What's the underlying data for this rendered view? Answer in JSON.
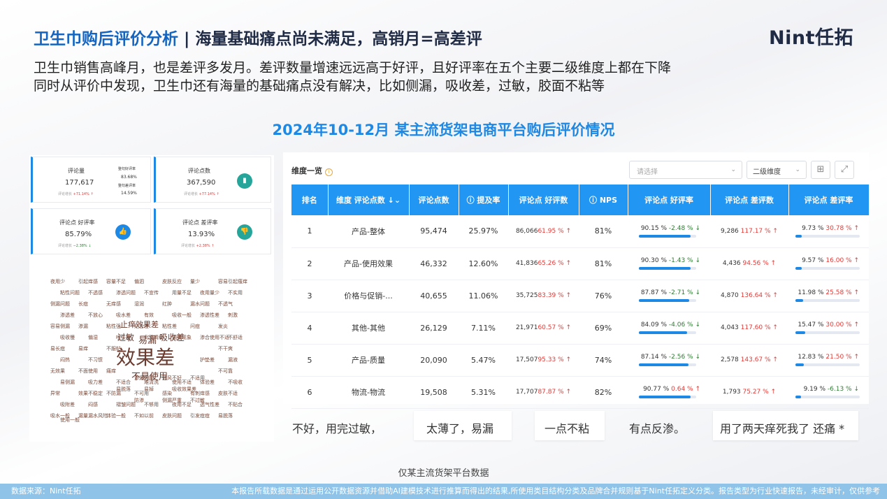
{
  "title": {
    "part1": "卫生巾购后评价分析",
    "sep": " | ",
    "part2": "海量基础痛点尚未满足，高销月=高差评"
  },
  "logo": "Nint任拓",
  "desc": [
    "卫生巾销售高峰月，也是差评多发月。差评数量增速远远高于好评，且好评率在五个主要二级维度上都在下降",
    "同时从评价中发现，卫生巾还有海量的基础痛点没有解决，比如侧漏，吸收差，过敏，胶面不粘等"
  ],
  "subtitle": "2024年10-12月 某主流货架电商平台购后评价情况",
  "stats": {
    "reviews": {
      "label": "评论量",
      "value": "177,617",
      "change_prefix": "评论增长",
      "change": "+71.14% ↑",
      "mini1_label": "整句好评率",
      "mini1": "83.68%",
      "mini2_label": "整句差评率",
      "mini2": "14.59%"
    },
    "points": {
      "label": "评论点数",
      "value": "367,590",
      "change_prefix": "评论增长",
      "change": "+77.14% ↑"
    },
    "good": {
      "label": "评论点 好评率",
      "value": "85.79%",
      "change_prefix": "评论增长",
      "change": "−2.38% ↓"
    },
    "bad": {
      "label": "评论点 差评率",
      "value": "13.93%",
      "change_prefix": "评论增长",
      "change": "+2.38% ↑"
    }
  },
  "cloud": {
    "big": "效果差",
    "mid": [
      "止痒效果差",
      "易漏",
      "吸收差",
      "过敏",
      "不易使用"
    ],
    "small": [
      "夜用少",
      "引起痒感",
      "容量不足",
      "偏泗",
      "皮肤反应",
      "量少",
      "容易引起瘙痒",
      "粘性问题",
      "不透感",
      "渗透问题",
      "不宣传",
      "用量不足",
      "夜用量少",
      "不实用",
      "侧漏问题",
      "长痘",
      "无痒感",
      "湿润",
      "红肿",
      "漏水问题",
      "不透气",
      "渗透差",
      "不放心",
      "吸水差",
      "有效",
      "吸收一般",
      "渗透性差",
      "刺激",
      "容易侧漏",
      "渗漏",
      "粘性强",
      "贴合差",
      "粘性差",
      "问痘",
      "发炎",
      "吸收慢",
      "偏湿",
      "喷头差",
      "负面情绪",
      "漏液现象",
      "渗合使用不适",
      "不舒适",
      "易长痘",
      "易痒",
      "不服帖",
      "渗漏问题",
      "通风不好",
      "不适用",
      "不干爽",
      "闷热",
      "不习惯",
      "易脱落",
      "易掉",
      "吸收效果差",
      "护垫差",
      "漏液",
      "无效果",
      "不面使用",
      "痛痒",
      "防渗",
      "侧漏严重",
      "不过敏",
      "不可靠",
      "易侧漏",
      "吸力差",
      "不适合",
      "难清洗",
      "使用不适",
      "体验差",
      "不吸收",
      "异常",
      "效果不稳定",
      "不防漏",
      "不可用",
      "感染",
      "有刺痒感",
      "皮肤不适",
      "吸附差",
      "闷感",
      "褶皱问题",
      "不够用",
      "夜用不足",
      "透气性差",
      "不贴合",
      "吸水一般",
      "漏量",
      "体验一般",
      "不如以前",
      "皮肤问题",
      "引发痘痘",
      "易脱落",
      "使用一般",
      "漏水风险"
    ]
  },
  "table": {
    "title": "维度一览",
    "select_placeholder": "请选择",
    "select2": "二级维度",
    "headers": [
      "排名",
      "维度 评论点数 ↓⌄",
      "评论点数",
      "ⓘ 提及率",
      "评论点 好评数",
      "ⓘ NPS",
      "评论点 好评率",
      "评论点 差评数",
      "评论点 差评率"
    ],
    "rows": [
      {
        "rank": "1",
        "dim": "产品-整体",
        "points": "95,474",
        "mention": "25.97%",
        "good_n": "86,066",
        "good_chg": "61.95 % ↑",
        "nps": "81%",
        "good_rate": "90.15 %",
        "good_rate_chg": "-2.48 % ↓",
        "good_fill": 0.9,
        "bad_n": "9,286",
        "bad_chg": "117.17 % ↑",
        "bad_rate": "9.73 %",
        "bad_rate_chg": "30.78 % ↑",
        "bad_fill": 0.097
      },
      {
        "rank": "2",
        "dim": "产品-使用效果",
        "points": "46,332",
        "mention": "12.60%",
        "good_n": "41,836",
        "good_chg": "65.26 % ↑",
        "nps": "81%",
        "good_rate": "90.30 %",
        "good_rate_chg": "-1.43 % ↓",
        "good_fill": 0.903,
        "bad_n": "4,436",
        "bad_chg": "94.56 % ↑",
        "bad_rate": "9.57 %",
        "bad_rate_chg": "16.00 % ↑",
        "bad_fill": 0.096
      },
      {
        "rank": "3",
        "dim": "价格与促销-...",
        "points": "40,655",
        "mention": "11.06%",
        "good_n": "35,725",
        "good_chg": "83.39 % ↑",
        "nps": "76%",
        "good_rate": "87.87 %",
        "good_rate_chg": "-2.71 % ↓",
        "good_fill": 0.879,
        "bad_n": "4,870",
        "bad_chg": "136.64 % ↑",
        "bad_rate": "11.98 %",
        "bad_rate_chg": "25.58 % ↑",
        "bad_fill": 0.12
      },
      {
        "rank": "4",
        "dim": "其他-其他",
        "points": "26,129",
        "mention": "7.11%",
        "good_n": "21,971",
        "good_chg": "60.57 % ↑",
        "nps": "69%",
        "good_rate": "84.09 %",
        "good_rate_chg": "-4.06 % ↓",
        "good_fill": 0.841,
        "bad_n": "4,043",
        "bad_chg": "117.60 % ↑",
        "bad_rate": "15.47 %",
        "bad_rate_chg": "30.00 % ↑",
        "bad_fill": 0.155
      },
      {
        "rank": "5",
        "dim": "产品-质量",
        "points": "20,090",
        "mention": "5.47%",
        "good_n": "17,507",
        "good_chg": "95.33 % ↑",
        "nps": "74%",
        "good_rate": "87.14 %",
        "good_rate_chg": "-2.56 % ↓",
        "good_fill": 0.871,
        "bad_n": "2,578",
        "bad_chg": "143.67 % ↑",
        "bad_rate": "12.83 %",
        "bad_rate_chg": "21.50 % ↑",
        "bad_fill": 0.128
      },
      {
        "rank": "6",
        "dim": "物流-物流",
        "points": "19,508",
        "mention": "5.31%",
        "good_n": "17,707",
        "good_chg": "87.87 % ↑",
        "nps": "82%",
        "good_rate": "90.77 %",
        "good_rate_chg": "0.64 % ↑",
        "good_fill": 0.908,
        "bad_n": "1,793",
        "bad_chg": "75.27 % ↑",
        "bad_rate": "9.19 %",
        "bad_rate_chg": "-6.13 % ↓",
        "bad_fill": 0.092
      }
    ]
  },
  "quotes": [
    "不好，用完过敏，",
    "太薄了，易漏",
    "一点不粘",
    "有点反渗。",
    "用了两天痒死我了 还痛 *"
  ],
  "source_note": "仅某主流货架平台数据",
  "footer": {
    "left": "数据来源：Nint任拓",
    "right": "本报告所载数据是通过运用公开数据资源并借助AI建模技术进行推算而得出的结果,所使用类目结构分类及品牌合并规则基于Nint任拓定义分类。报告类型为行业快速报告，未经审计，仅供参考"
  },
  "colors": {
    "accent": "#1e88e5",
    "up": "#e53935",
    "down": "#2e7d32",
    "header": "#2196f3"
  }
}
